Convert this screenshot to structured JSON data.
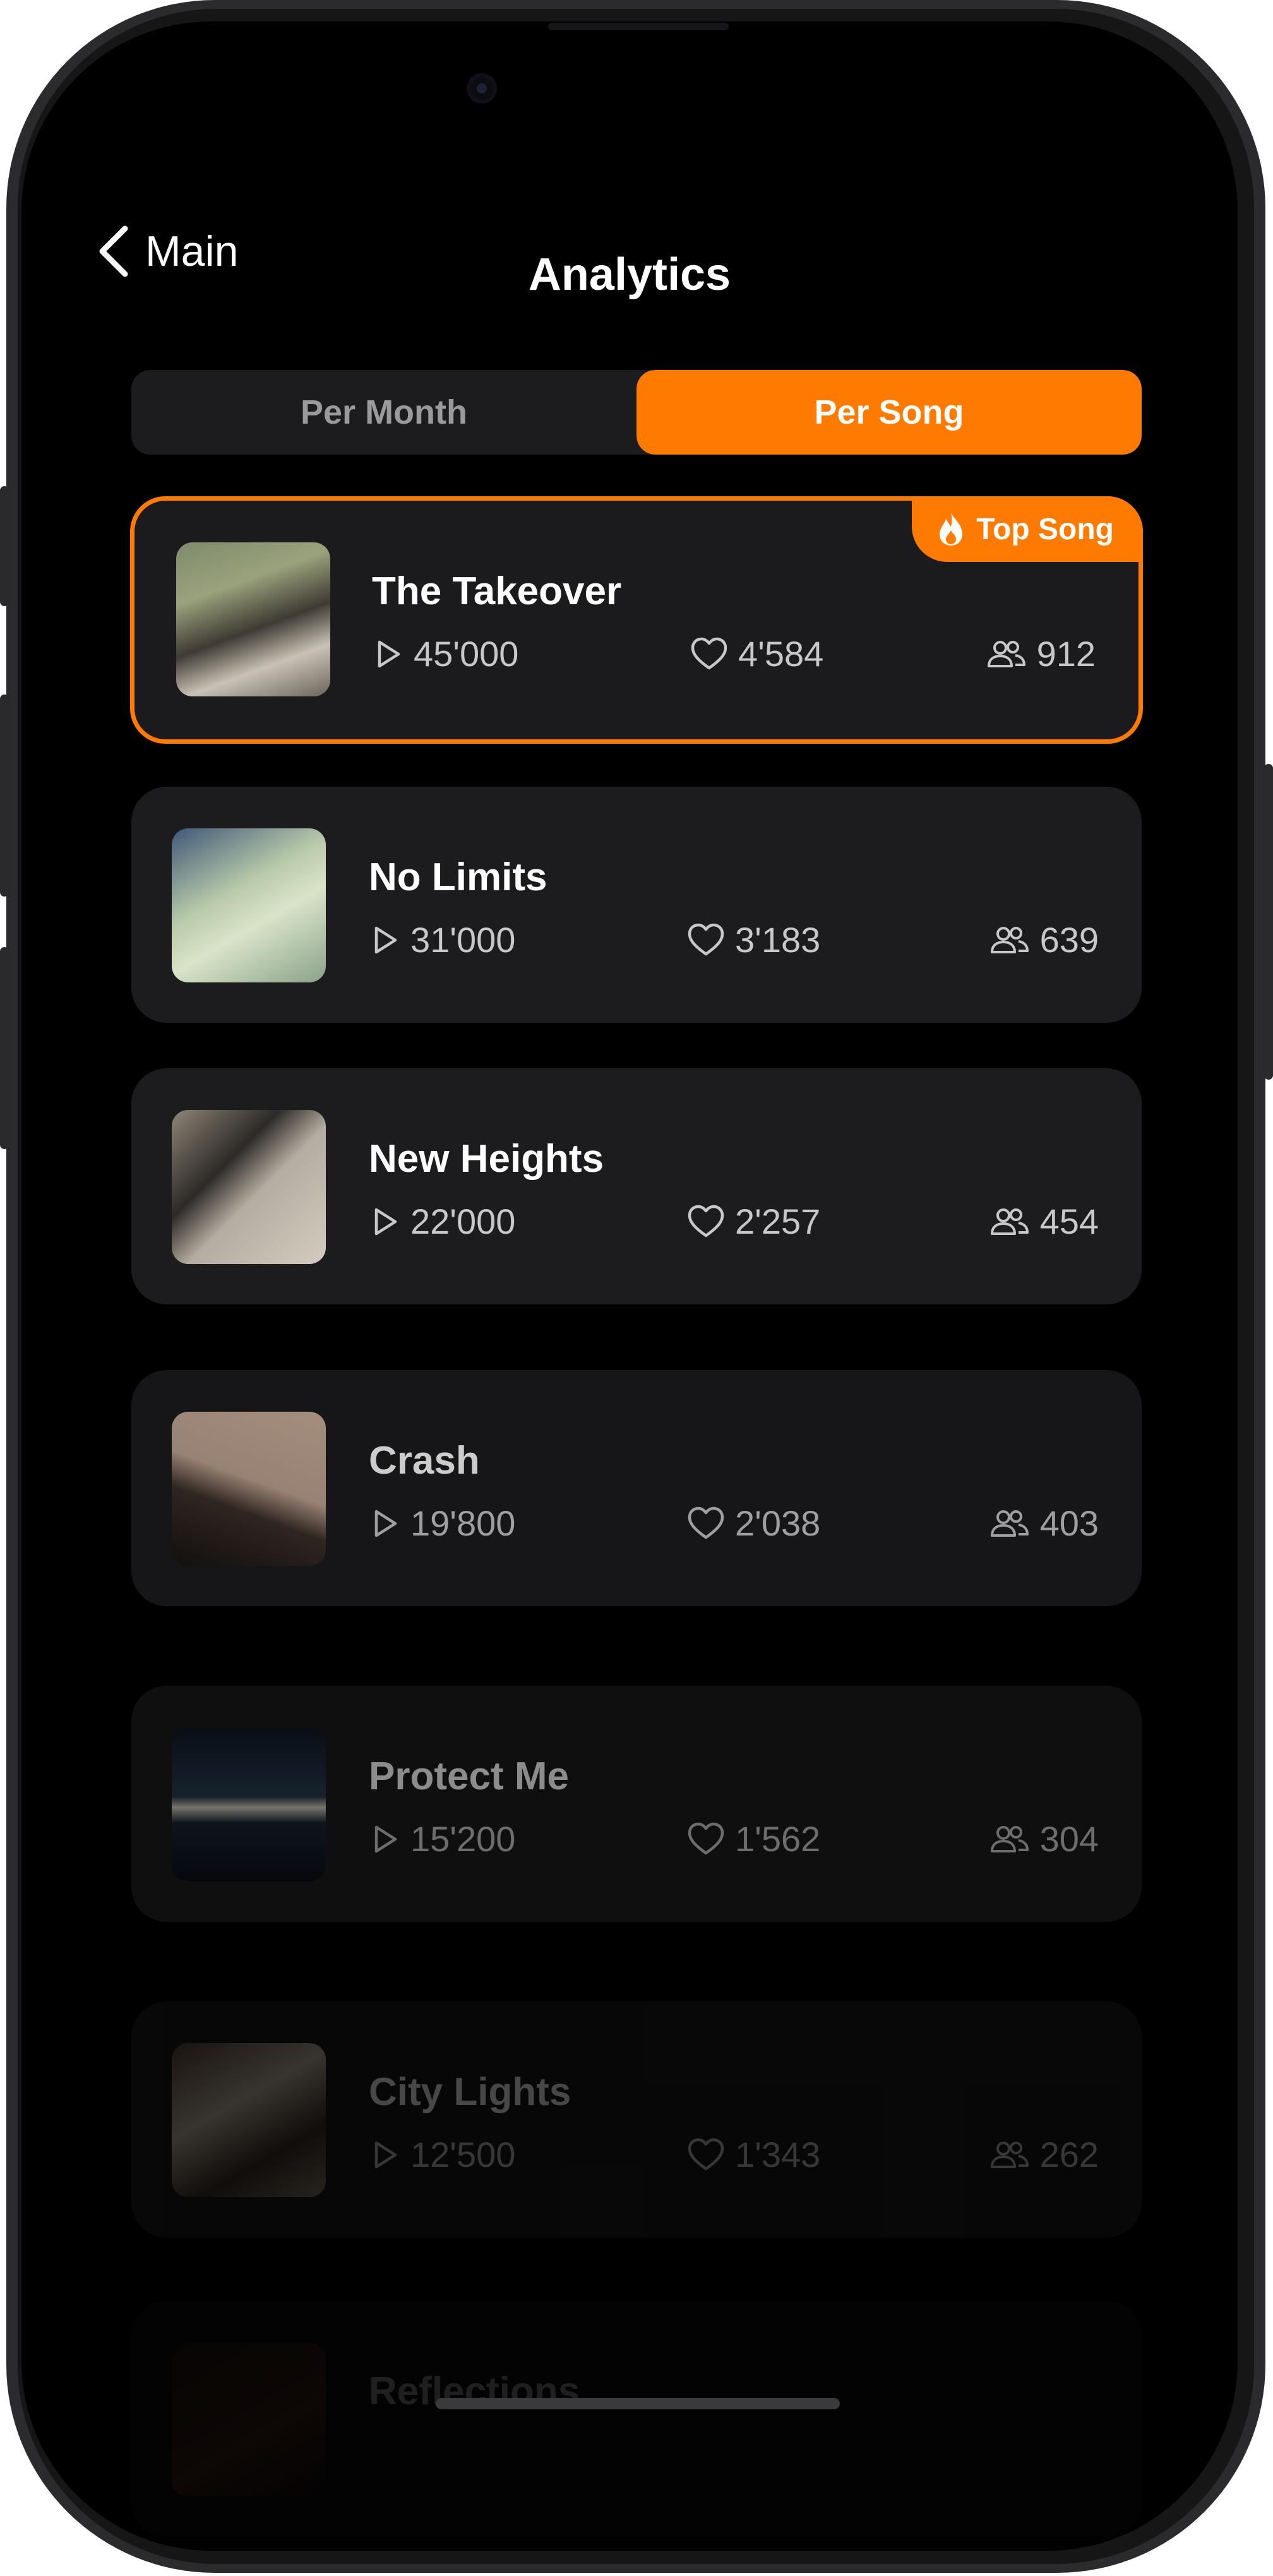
{
  "nav": {
    "back_label": "Main",
    "title": "Analytics"
  },
  "tabs": [
    {
      "label": "Per Month",
      "active": false
    },
    {
      "label": "Per Song",
      "active": true
    }
  ],
  "badge": {
    "label": "Top Song",
    "icon": "flame-icon"
  },
  "colors": {
    "accent": "#ff7a00",
    "card": "#1c1c1e",
    "background": "#000000"
  },
  "songs": [
    {
      "title": "The Takeover",
      "plays": "45'000",
      "likes": "4'584",
      "listeners": "912",
      "top": true,
      "opacity": 1.0
    },
    {
      "title": "No Limits",
      "plays": "31'000",
      "likes": "3'183",
      "listeners": "639",
      "top": false,
      "opacity": 1.0
    },
    {
      "title": "New Heights",
      "plays": "22'000",
      "likes": "2'257",
      "listeners": "454",
      "top": false,
      "opacity": 1.0
    },
    {
      "title": "Crash",
      "plays": "19'800",
      "likes": "2'038",
      "listeners": "403",
      "top": false,
      "opacity": 0.8
    },
    {
      "title": "Protect Me",
      "plays": "15'200",
      "likes": "1'562",
      "listeners": "304",
      "top": false,
      "opacity": 0.55
    },
    {
      "title": "City Lights",
      "plays": "12'500",
      "likes": "1'343",
      "listeners": "262",
      "top": false,
      "opacity": 0.28
    },
    {
      "title": "Reflections",
      "plays": "",
      "likes": "",
      "listeners": "",
      "top": false,
      "opacity": 0.12
    }
  ],
  "icons": {
    "back": "chevron-left-icon",
    "plays": "play-icon",
    "likes": "heart-icon",
    "listeners": "people-icon"
  }
}
